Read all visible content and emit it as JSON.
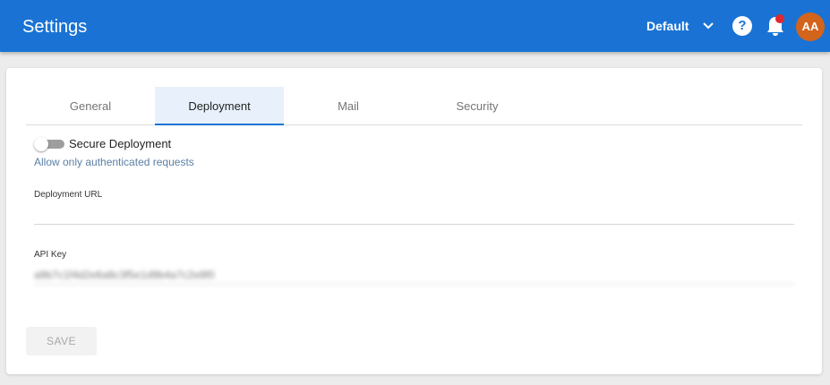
{
  "header": {
    "title": "Settings",
    "profile": "Default",
    "help_glyph": "?",
    "avatar_initials": "AA",
    "icons": [
      "chevron-down-icon",
      "help-icon",
      "bell-icon",
      "notification-dot"
    ],
    "colors": {
      "bar": "#1a73d4",
      "avatar": "#d2641c",
      "badge": "#e0282e"
    }
  },
  "tabs": [
    {
      "label": "General",
      "active": false
    },
    {
      "label": "Deployment",
      "active": true
    },
    {
      "label": "Mail",
      "active": false
    },
    {
      "label": "Security",
      "active": false
    }
  ],
  "deployment": {
    "secure": {
      "label": "Secure Deployment",
      "hint": "Allow only authenticated requests",
      "enabled": false
    },
    "url": {
      "label": "Deployment URL",
      "value": ""
    },
    "api_key": {
      "label": "API Key",
      "value": "a9b7c1f4d2e6a8c3f5e1d9b4a7c2e8f0"
    },
    "save_label": "SAVE"
  }
}
